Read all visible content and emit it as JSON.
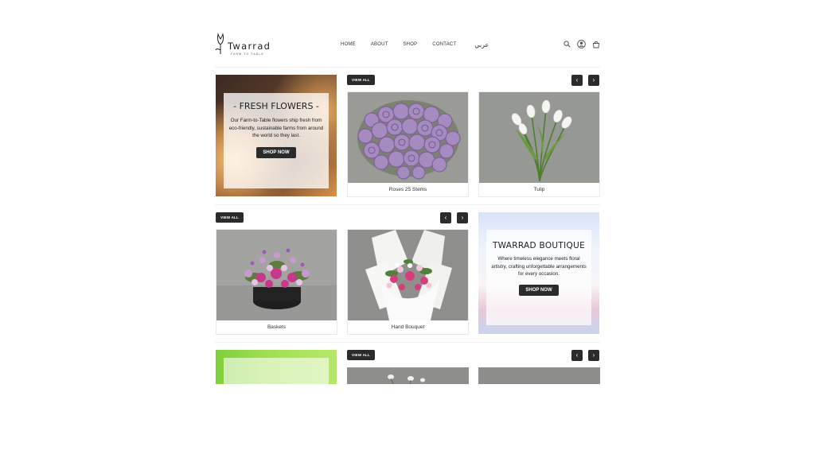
{
  "brand": {
    "name": "Twarrad",
    "tagline": "FARM TO TABLE"
  },
  "nav": {
    "home": "HOME",
    "about": "ABOUT",
    "shop": "SHOP",
    "contact": "CONTACT",
    "arabic": "عربي"
  },
  "header_icons": [
    "search-icon",
    "user-icon",
    "cart-icon"
  ],
  "section1": {
    "view_all": "VIEW ALL",
    "promo": {
      "title": "- FRESH FLOWERS -",
      "description": "Our Farm-to-Table flowers ship fresh from eco-friendly, sustainable farms from around the world so they last.",
      "button": "SHOP NOW"
    },
    "products": [
      {
        "name": "Roses 25 Stems"
      },
      {
        "name": "Tulip"
      }
    ]
  },
  "section2": {
    "view_all": "VIEW ALL",
    "products": [
      {
        "name": "Baskets"
      },
      {
        "name": "Hand Bouquet"
      }
    ],
    "promo": {
      "title": "TWARRAD BOUTIQUE",
      "description": "Where timeless elegance meets floral artistry, crafting unforgettable arrangements for every occasion.",
      "button": "SHOP NOW"
    }
  },
  "section3": {
    "view_all": "VIEW ALL"
  },
  "arrows": {
    "prev": "‹",
    "next": "›"
  },
  "colors": {
    "button_bg": "#2b2b2b",
    "button_text": "#ffffff"
  }
}
